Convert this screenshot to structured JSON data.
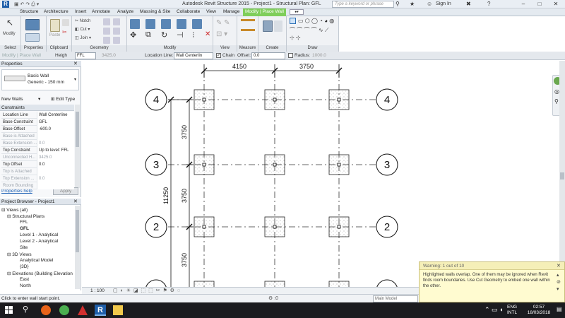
{
  "window": {
    "title": "Autodesk Revit Structure 2015 -    Project1 - Structural Plan: GFL",
    "search_placeholder": "Type a keyword or phrase",
    "sign_in": "Sign In"
  },
  "ribbon_tabs": [
    "Structure",
    "Architecture",
    "Insert",
    "Annotate",
    "Analyze",
    "Massing & Site",
    "Collaborate",
    "View",
    "Manage",
    "Modify | Place Wall"
  ],
  "ribbon": {
    "modify_label": "Modify",
    "geometry_buttons": [
      "Notch",
      "Cut",
      "Join"
    ],
    "panels": [
      "Select",
      "Properties",
      "Clipboard",
      "Geometry",
      "Modify",
      "View",
      "Measure",
      "Create",
      "Draw"
    ]
  },
  "options_bar": {
    "context": "Modify | Place Wall",
    "height_label": "Heigh",
    "height_value": "FFL",
    "height_number": "3425.0",
    "location_line_label": "Location Line:",
    "location_line_value": "Wall Centerlin",
    "chain_label": "Chain",
    "offset_label": "Offset:",
    "offset_value": "0.0",
    "radius_label": "Radius:",
    "radius_value": "1000.0"
  },
  "properties": {
    "title": "Properties",
    "type_name": "Basic Wall",
    "type_sub": "Generic - 150 mm",
    "instance_filter": "New Walls",
    "edit_type": "Edit Type",
    "section": "Constraints",
    "rows": [
      {
        "k": "Location Line",
        "v": "Wall Centerline",
        "dis": false
      },
      {
        "k": "Base Constraint",
        "v": "GFL",
        "dis": false
      },
      {
        "k": "Base Offset",
        "v": "-600.0",
        "dis": false
      },
      {
        "k": "Base is Attached",
        "v": "",
        "dis": true
      },
      {
        "k": "Base Extension ...",
        "v": "0.0",
        "dis": true
      },
      {
        "k": "Top Constraint",
        "v": "Up to level: FFL",
        "dis": false
      },
      {
        "k": "Unconnected H...",
        "v": "3425.0",
        "dis": true
      },
      {
        "k": "Top Offset",
        "v": "0.0",
        "dis": false
      },
      {
        "k": "Top is Attached",
        "v": "",
        "dis": true
      },
      {
        "k": "Top Extension ...",
        "v": "0.0",
        "dis": true
      },
      {
        "k": "Room Bounding",
        "v": "",
        "dis": true
      }
    ],
    "help": "Properties help",
    "apply": "Apply"
  },
  "project_browser": {
    "title": "Project Browser - Project1",
    "items": [
      "Views (all)",
      "Structural Plans",
      "FFL",
      "GFL",
      "Level 1 - Analytical",
      "Level 2 - Analytical",
      "Site",
      "3D Views",
      "Analytical Model",
      "{3D}",
      "Elevations (Building Elevation",
      "East",
      "North"
    ]
  },
  "drawing": {
    "grid_rows": [
      "4",
      "3",
      "2"
    ],
    "dim_top": [
      "4150",
      "3750"
    ],
    "dim_left": [
      "3750",
      "3750",
      "3750"
    ],
    "dim_total": "11250"
  },
  "view_bar": {
    "scale": "1 : 100"
  },
  "status": {
    "text": "Click to enter wall start point.",
    "model": "Main Model"
  },
  "warning": {
    "title": "Warning: 1 out of 10",
    "message": "Highlighted walls overlap. One of them may be ignored when Revit finds room boundaries. Use Cut Geometry to embed one wall within the other."
  },
  "taskbar": {
    "lang": "ENG",
    "layout": "INTL",
    "time": "02:57",
    "date": "18/03/2018"
  }
}
